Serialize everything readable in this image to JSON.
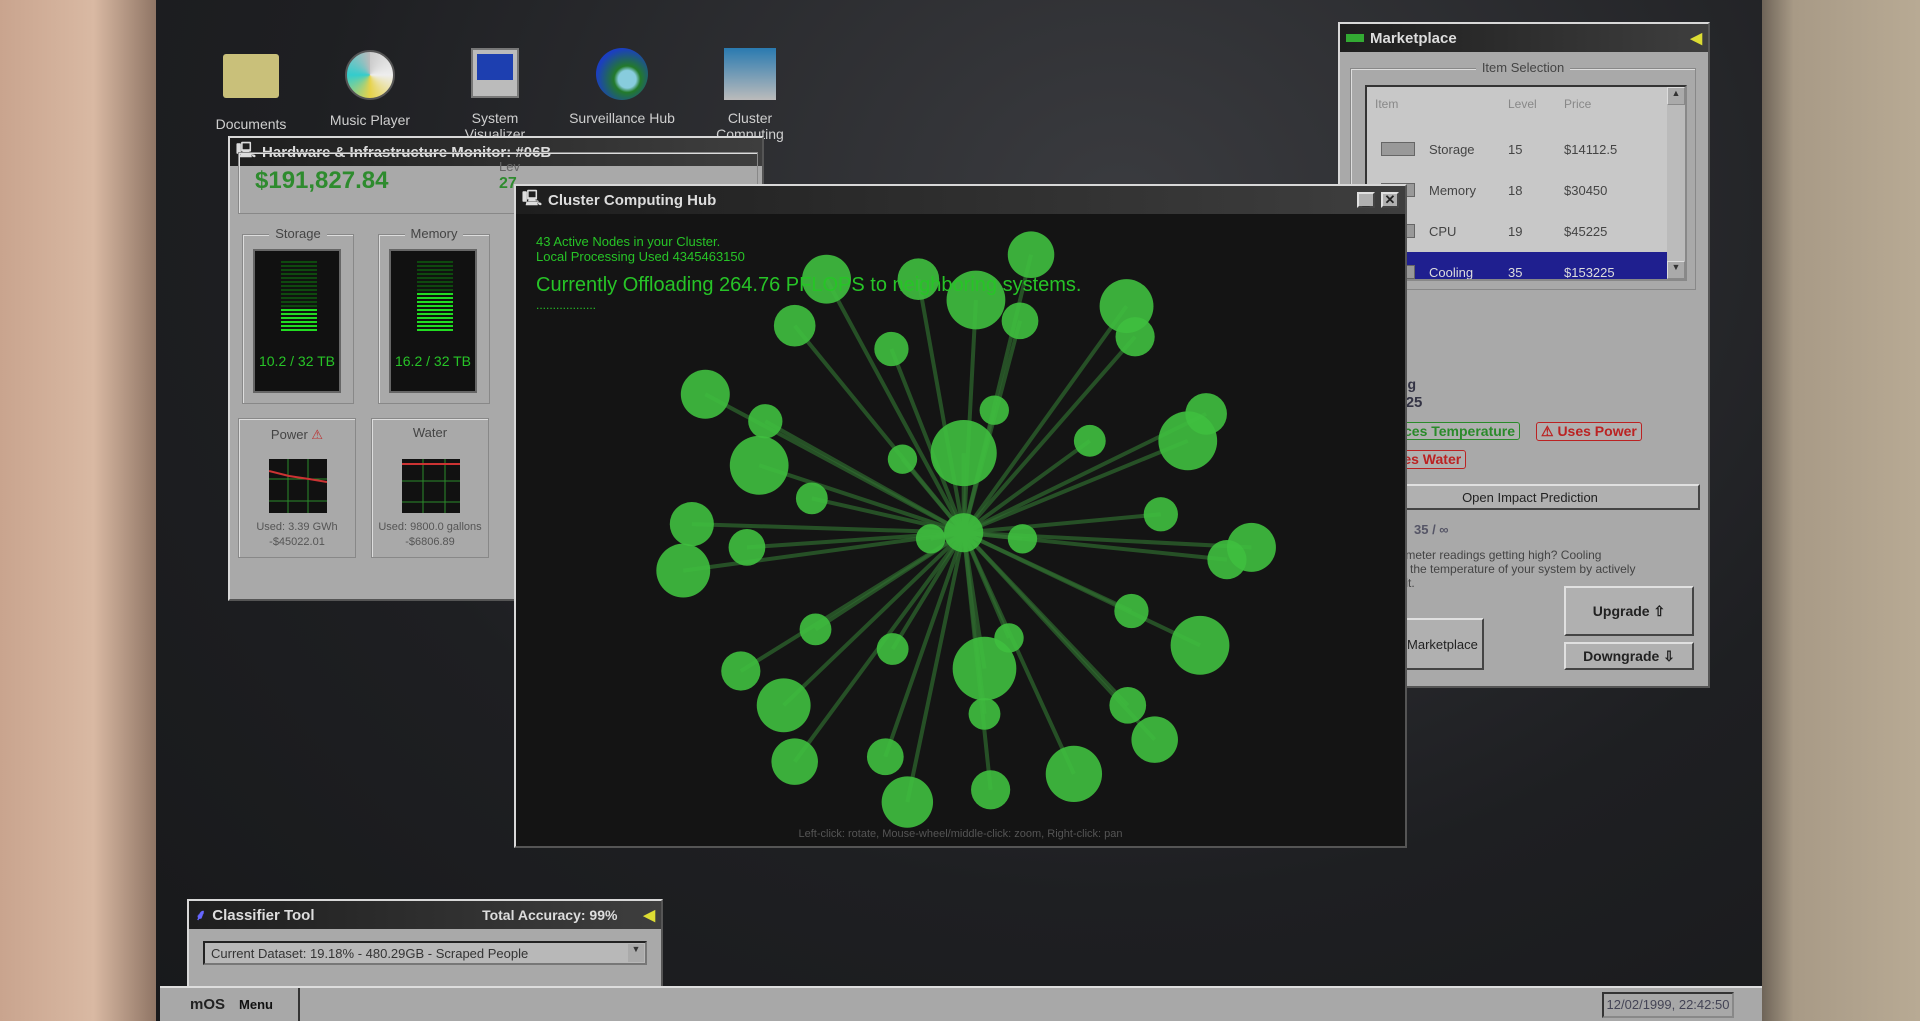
{
  "desktop": {
    "icons": [
      {
        "label": "Documents",
        "icon": "folder-icon"
      },
      {
        "label": "Music Player",
        "icon": "cd-icon"
      },
      {
        "label": "System Visualizer",
        "icon": "computer-icon"
      },
      {
        "label": "Surveillance Hub",
        "icon": "globe-magnifier-icon"
      },
      {
        "label": "Cluster Computing",
        "icon": "network-computers-icon"
      }
    ]
  },
  "hw_monitor": {
    "title": "Hardware & Infrastructure Monitor: #06B",
    "balance": "$191,827.84",
    "level_label": "Lev",
    "level_value": "27",
    "storage": {
      "label": "Storage",
      "value": "10.2 / 32 TB",
      "fill": 0.32
    },
    "memory": {
      "label": "Memory",
      "value": "16.2 / 32 TB",
      "fill": 0.51
    },
    "power": {
      "label": "Power",
      "warning": "⚠",
      "used": "Used: 3.39 GWh",
      "cost": "-$45022.01"
    },
    "water": {
      "label": "Water",
      "used": "Used: 9800.0 gallons",
      "cost": "-$6806.89"
    }
  },
  "cluster": {
    "title": "Cluster Computing Hub",
    "nodes_text": "43 Active Nodes in your Cluster.",
    "local_text": "Local Processing Used 4345463150",
    "offload_text": "Currently Offloading 264.76 PFLOPS to neighboring systems.",
    "dots": "..................",
    "hint": "Left-click: rotate, Mouse-wheel/middle-click: zoom, Right-click: pan",
    "node_color": "#3fbf3f"
  },
  "marketplace": {
    "title": "Marketplace",
    "group_label": "Item Selection",
    "columns": [
      "Item",
      "Level",
      "Price"
    ],
    "items": [
      {
        "name": "Storage",
        "level": "15",
        "price": "$14112.5"
      },
      {
        "name": "Memory",
        "level": "18",
        "price": "$30450"
      },
      {
        "name": "CPU",
        "level": "19",
        "price": "$45225"
      },
      {
        "name": "Cooling",
        "level": "35",
        "price": "$153225"
      }
    ],
    "selected_name": "Cooling",
    "selected_price": "$153225",
    "tag_good": "Reduces Temperature",
    "tag_power": "⚠ Uses Power",
    "tag_water": "⚠ Uses Water",
    "impact_btn": "Open Impact Prediction",
    "level_range": "35 / ∞",
    "desc": "Thermometer readings getting high? Cooling reduces the temperature of your system by actively cooling it.",
    "upgrade": "Upgrade ⇧",
    "downgrade": "Downgrade ⇩",
    "back": "Close Marketplace",
    "select_color": "#1f1f8f"
  },
  "classifier": {
    "title": "Classifier Tool",
    "accuracy": "Total Accuracy: 99%",
    "dataset": "Current Dataset: 19.18% - 480.29GB - Scraped People"
  },
  "taskbar": {
    "logo": "mOS",
    "menu": "Menu",
    "clock": "12/02/1999, 22:42:50"
  }
}
